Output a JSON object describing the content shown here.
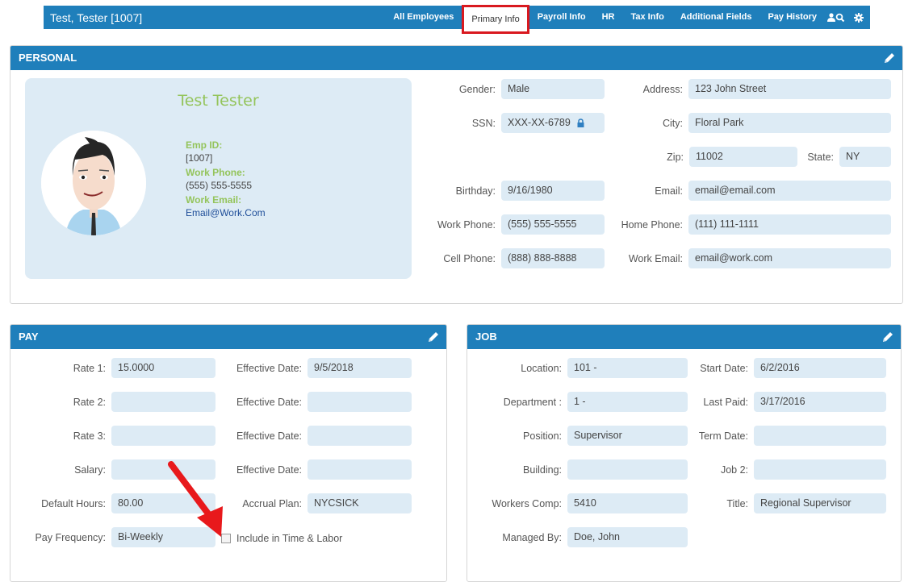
{
  "header": {
    "employee_title": "Test, Tester [1007]",
    "tabs": [
      {
        "label": "All Employees",
        "active": false
      },
      {
        "label": "Primary Info",
        "active": true
      },
      {
        "label": "Payroll Info",
        "active": false
      },
      {
        "label": "HR",
        "active": false
      },
      {
        "label": "Tax Info",
        "active": false
      },
      {
        "label": "Additional Fields",
        "active": false
      },
      {
        "label": "Pay History",
        "active": false
      }
    ],
    "icons": [
      "user-search-icon",
      "gear-icon"
    ]
  },
  "personal": {
    "heading": "PERSONAL",
    "card": {
      "full_name": "Test Tester",
      "emp_id_label": "Emp ID:",
      "emp_id": "[1007]",
      "work_phone_label": "Work Phone:",
      "work_phone": "(555) 555-5555",
      "work_email_label": "Work Email:",
      "work_email": "Email@Work.Com"
    },
    "fields": {
      "gender": {
        "label": "Gender:",
        "value": "Male"
      },
      "ssn": {
        "label": "SSN:",
        "value": "XXX-XX-6789"
      },
      "birthday": {
        "label": "Birthday:",
        "value": "9/16/1980"
      },
      "work_phone": {
        "label": "Work Phone:",
        "value": "(555) 555-5555"
      },
      "cell_phone": {
        "label": "Cell Phone:",
        "value": "(888) 888-8888"
      },
      "address": {
        "label": "Address:",
        "value": "123 John Street"
      },
      "city": {
        "label": "City:",
        "value": "Floral Park"
      },
      "zip": {
        "label": "Zip:",
        "value": "11002"
      },
      "state": {
        "label": "State:",
        "value": "NY"
      },
      "email": {
        "label": "Email:",
        "value": "email@email.com"
      },
      "home_phone": {
        "label": "Home Phone:",
        "value": "(111) 111-1111"
      },
      "work_email": {
        "label": "Work Email:",
        "value": "email@work.com"
      }
    }
  },
  "pay": {
    "heading": "PAY",
    "fields": {
      "rate1": {
        "label": "Rate 1:",
        "value": "15.0000"
      },
      "rate2": {
        "label": "Rate 2:",
        "value": ""
      },
      "rate3": {
        "label": "Rate 3:",
        "value": ""
      },
      "salary": {
        "label": "Salary:",
        "value": ""
      },
      "default_hours": {
        "label": "Default Hours:",
        "value": "80.00"
      },
      "pay_frequency": {
        "label": "Pay Frequency:",
        "value": "Bi-Weekly"
      },
      "eff1": {
        "label": "Effective Date:",
        "value": "9/5/2018"
      },
      "eff2": {
        "label": "Effective Date:",
        "value": ""
      },
      "eff3": {
        "label": "Effective Date:",
        "value": ""
      },
      "eff4": {
        "label": "Effective Date:",
        "value": ""
      },
      "accrual_plan": {
        "label": "Accrual Plan:",
        "value": "NYCSICK"
      }
    },
    "include_time_labor": {
      "label": "Include in Time & Labor",
      "checked": false
    }
  },
  "job": {
    "heading": "JOB",
    "fields": {
      "location": {
        "label": "Location:",
        "value": "101 -"
      },
      "department": {
        "label": "Department :",
        "value": "1 -"
      },
      "position": {
        "label": "Position:",
        "value": "Supervisor"
      },
      "building": {
        "label": "Building:",
        "value": ""
      },
      "workers_comp": {
        "label": "Workers Comp:",
        "value": "5410"
      },
      "managed_by": {
        "label": "Managed By:",
        "value": "Doe, John"
      },
      "start_date": {
        "label": "Start Date:",
        "value": "6/2/2016"
      },
      "last_paid": {
        "label": "Last Paid:",
        "value": "3/17/2016"
      },
      "term_date": {
        "label": "Term Date:",
        "value": ""
      },
      "job2": {
        "label": "Job 2:",
        "value": ""
      },
      "title": {
        "label": "Title:",
        "value": "Regional Supervisor"
      }
    }
  },
  "annotation": {
    "arrow_color": "#e8191c",
    "highlight_color": "#d9191f"
  }
}
